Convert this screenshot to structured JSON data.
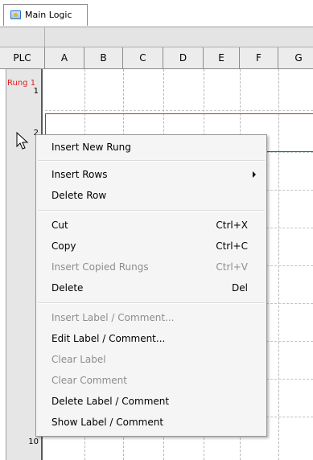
{
  "tab": {
    "label": "Main Logic"
  },
  "columns": {
    "row_header": "PLC",
    "letters": [
      "A",
      "B",
      "C",
      "D",
      "E",
      "F",
      "G"
    ]
  },
  "rungs": {
    "label": "Rung 1",
    "numbers": {
      "r1": "1",
      "r2": "2",
      "r10": "10"
    }
  },
  "colors": {
    "rung_accent": "#e02020",
    "menu_bg": "#f5f5f5",
    "disabled_text": "#8d8d8d"
  },
  "context_menu": {
    "insert_new_rung": {
      "label": "Insert New Rung"
    },
    "insert_rows": {
      "label": "Insert Rows",
      "submenu_icon": "submenu-arrow"
    },
    "delete_row": {
      "label": "Delete Row"
    },
    "cut": {
      "label": "Cut",
      "shortcut": "Ctrl+X"
    },
    "copy": {
      "label": "Copy",
      "shortcut": "Ctrl+C"
    },
    "insert_copied_rungs": {
      "label": "Insert Copied Rungs",
      "shortcut": "Ctrl+V",
      "enabled": false
    },
    "delete": {
      "label": "Delete",
      "shortcut": "Del"
    },
    "insert_label_comment": {
      "label": "Insert Label / Comment...",
      "enabled": false
    },
    "edit_label_comment": {
      "label": "Edit Label / Comment..."
    },
    "clear_label": {
      "label": "Clear Label",
      "enabled": false
    },
    "clear_comment": {
      "label": "Clear Comment",
      "enabled": false
    },
    "delete_label_comment": {
      "label": "Delete Label / Comment"
    },
    "show_label_comment": {
      "label": "Show Label / Comment"
    }
  }
}
